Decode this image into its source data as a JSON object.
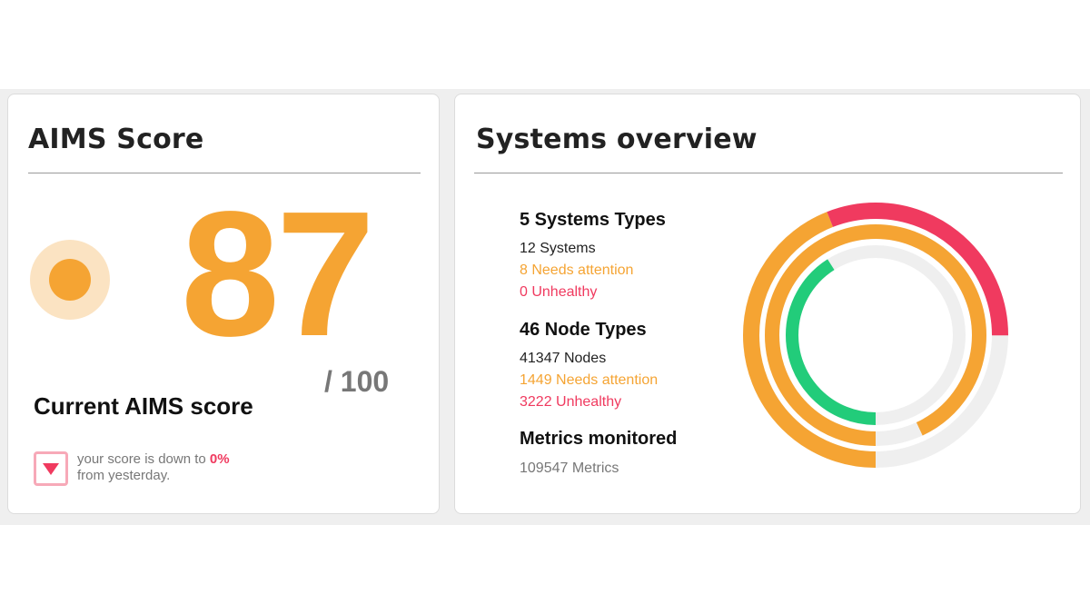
{
  "aims": {
    "title": "AIMS Score",
    "score": "87",
    "max": "/ 100",
    "label": "Current AIMS score",
    "trend_prefix": "your score is down to ",
    "trend_value": "0%",
    "trend_suffix": "from yesterday."
  },
  "systems": {
    "title": "Systems overview",
    "system_types": "5 Systems Types",
    "systems_count": "12 Systems",
    "systems_attention": "8 Needs attention",
    "systems_unhealthy": "0 Unhealthy",
    "node_types": "46 Node Types",
    "nodes_count": "41347 Nodes",
    "nodes_attention": "1449 Needs attention",
    "nodes_unhealthy": "3222 Unhealthy",
    "metrics_title": "Metrics monitored",
    "metrics_count": "109547 Metrics"
  },
  "colors": {
    "warning": "#f5a433",
    "unhealthy": "#f03a5f",
    "healthy": "#22cc7a",
    "track": "#efefef"
  },
  "rings": [
    {
      "segments": [
        {
          "fraction": 0.44,
          "color": "#f5a433"
        },
        {
          "fraction": 0.31,
          "color": "#f03a5f"
        }
      ]
    },
    {
      "segments": [
        {
          "fraction": 0.93,
          "color": "#f5a433"
        }
      ]
    },
    {
      "segments": [
        {
          "fraction": 0.41,
          "color": "#22cc7a"
        }
      ]
    }
  ]
}
